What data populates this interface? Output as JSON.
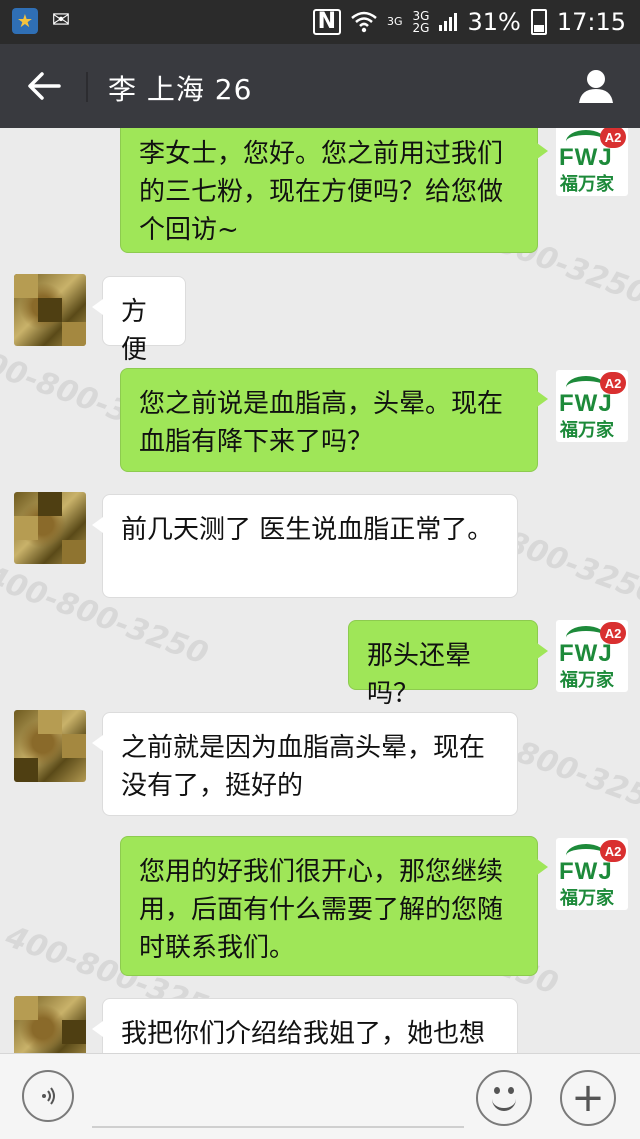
{
  "status_bar": {
    "network_top": "3G",
    "network_bottom": "2G",
    "network_label": "3G",
    "battery_percent": "31%",
    "time": "17:15",
    "icons": [
      "star-app-icon",
      "mail-icon",
      "nfc-icon",
      "wifi-icon",
      "signal-icon",
      "battery-icon"
    ]
  },
  "header": {
    "title": "李 上海 26",
    "back_icon": "arrow-left-icon",
    "profile_icon": "person-icon"
  },
  "brand_avatar": {
    "latin": "FWJ",
    "chinese": "福万家",
    "badge": "A2",
    "accent": "#1d8a3a"
  },
  "watermark_text": "400-800-3250",
  "messages": [
    {
      "side": "out",
      "text": "李女士，您好。您之前用过我们的三七粉，现在方便吗？给您做个回访~"
    },
    {
      "side": "in",
      "text": "方便"
    },
    {
      "side": "out",
      "text": "您之前说是血脂高，头晕。现在血脂有降下来了吗？"
    },
    {
      "side": "in",
      "text": "前几天测了  医生说血脂正常了。"
    },
    {
      "side": "out",
      "text": "那头还晕吗？"
    },
    {
      "side": "in",
      "text": "之前就是因为血脂高头晕，现在没有了，挺好的"
    },
    {
      "side": "out",
      "text": "您用的好我们很开心，那您继续用，后面有什么需要了解的您随时联系我们。"
    },
    {
      "side": "in",
      "text": "我把你们介绍给我姐了，她也想"
    }
  ],
  "input_bar": {
    "voice_icon": "voice-icon",
    "emoji_icon": "emoji-icon",
    "plus_icon": "plus-icon",
    "input_value": ""
  },
  "colors": {
    "outgoing_bubble": "#9fe658",
    "incoming_bubble": "#ffffff",
    "titlebar": "#393a3f",
    "statusbar": "#2b2b2b",
    "background": "#ebebeb"
  }
}
